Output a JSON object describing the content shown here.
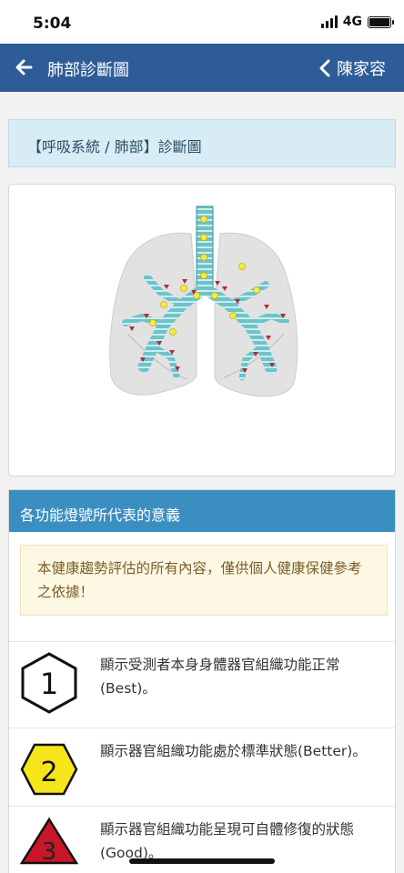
{
  "status_bar": {
    "time": "5:04",
    "network": "4G"
  },
  "navbar": {
    "title": "肺部診斷圖",
    "user_name": "陳家容"
  },
  "section_heading": "【呼吸系統 / 肺部】診斷圖",
  "meaning": {
    "header": "各功能燈號所代表的意義",
    "notice": "本健康趨勢評估的所有內容，僅供個人健康保健參考之依據！",
    "levels": [
      {
        "number": "1",
        "shape": "hexagon",
        "color": "#ffffff",
        "text": "顯示受測者本身身體器官組織功能正常(Best)。"
      },
      {
        "number": "2",
        "shape": "hexagon",
        "color": "#f7e51c",
        "text": "顯示器官組織功能處於標準狀態(Better)。"
      },
      {
        "number": "3",
        "shape": "triangle",
        "color": "#c8162a",
        "text": "顯示器官組織功能呈現可自體修復的狀態(Good)。"
      }
    ]
  },
  "colors": {
    "navbar": "#2e5c96",
    "heading_bg": "#d8ecf5",
    "card_header": "#3b8ec0",
    "notice_bg": "#fcf8e3"
  },
  "icons": {
    "back": "arrow-left-icon",
    "user": "chevron-left-icon"
  }
}
